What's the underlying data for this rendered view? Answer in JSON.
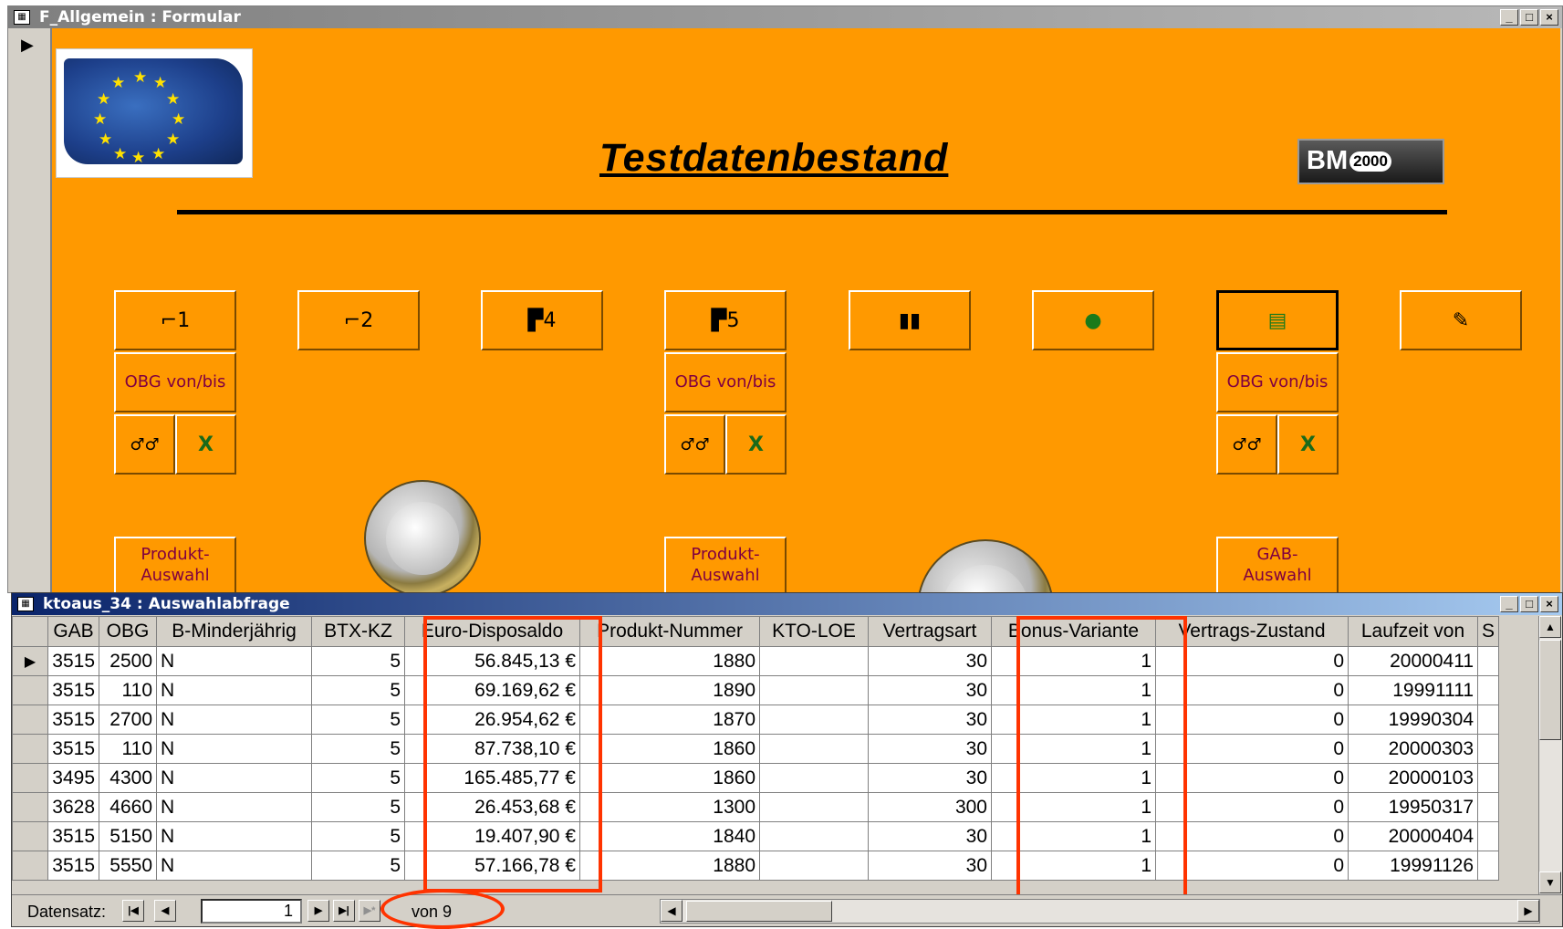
{
  "form_window": {
    "title": "F_Allgemein : Formular",
    "controls": {
      "minimize": "_",
      "maximize": "□",
      "close": "×"
    },
    "heading": "Testdatenbestand",
    "logo_text": "BM",
    "logo_year": "2000",
    "record_indicator": "▶",
    "buttons": {
      "b1": "⌐1",
      "b2": "⌐2",
      "b4": "▛4",
      "b5": "▛5",
      "chart": "▮▮",
      "globe": "●",
      "notebook": "▤",
      "report": "✎",
      "obg1": "OBG von/bis",
      "obg2": "OBG von/bis",
      "obg3": "OBG von/bis",
      "glasses": "♂♂",
      "excel": "X",
      "produkt1_l1": "Produkt-",
      "produkt1_l2": "Auswahl",
      "produkt2_l1": "Produkt-",
      "produkt2_l2": "Auswahl",
      "gab_l1": "GAB-",
      "gab_l2": "Auswahl"
    }
  },
  "query_window": {
    "title": "ktoaus_34 : Auswahlabfrage",
    "columns": [
      "GAB",
      "OBG",
      "B-Minderjährig",
      "BTX-KZ",
      "Euro-Disposaldo",
      "Produkt-Nummer",
      "KTO-LOE",
      "Vertragsart",
      "Bonus-Variante",
      "Vertrags-Zustand",
      "Laufzeit von",
      "S"
    ],
    "rows": [
      {
        "indicator": "▶",
        "gab": "3515",
        "obg": "2500",
        "minder": "N",
        "btx": "5",
        "euro": "56.845,13 €",
        "produkt": "1880",
        "kto": "",
        "vertragsart": "30",
        "bonus": "1",
        "zustand": "0",
        "laufzeit": "20000411",
        "s": ""
      },
      {
        "indicator": "",
        "gab": "3515",
        "obg": "110",
        "minder": "N",
        "btx": "5",
        "euro": "69.169,62 €",
        "produkt": "1890",
        "kto": "",
        "vertragsart": "30",
        "bonus": "1",
        "zustand": "0",
        "laufzeit": "19991111",
        "s": ""
      },
      {
        "indicator": "",
        "gab": "3515",
        "obg": "2700",
        "minder": "N",
        "btx": "5",
        "euro": "26.954,62 €",
        "produkt": "1870",
        "kto": "",
        "vertragsart": "30",
        "bonus": "1",
        "zustand": "0",
        "laufzeit": "19990304",
        "s": ""
      },
      {
        "indicator": "",
        "gab": "3515",
        "obg": "110",
        "minder": "N",
        "btx": "5",
        "euro": "87.738,10 €",
        "produkt": "1860",
        "kto": "",
        "vertragsart": "30",
        "bonus": "1",
        "zustand": "0",
        "laufzeit": "20000303",
        "s": ""
      },
      {
        "indicator": "",
        "gab": "3495",
        "obg": "4300",
        "minder": "N",
        "btx": "5",
        "euro": "165.485,77 €",
        "produkt": "1860",
        "kto": "",
        "vertragsart": "30",
        "bonus": "1",
        "zustand": "0",
        "laufzeit": "20000103",
        "s": ""
      },
      {
        "indicator": "",
        "gab": "3628",
        "obg": "4660",
        "minder": "N",
        "btx": "5",
        "euro": "26.453,68 €",
        "produkt": "1300",
        "kto": "",
        "vertragsart": "300",
        "bonus": "1",
        "zustand": "0",
        "laufzeit": "19950317",
        "s": ""
      },
      {
        "indicator": "",
        "gab": "3515",
        "obg": "5150",
        "minder": "N",
        "btx": "5",
        "euro": "19.407,90 €",
        "produkt": "1840",
        "kto": "",
        "vertragsart": "30",
        "bonus": "1",
        "zustand": "0",
        "laufzeit": "20000404",
        "s": ""
      },
      {
        "indicator": "",
        "gab": "3515",
        "obg": "5550",
        "minder": "N",
        "btx": "5",
        "euro": "57.166,78 €",
        "produkt": "1880",
        "kto": "",
        "vertragsart": "30",
        "bonus": "1",
        "zustand": "0",
        "laufzeit": "19991126",
        "s": ""
      }
    ],
    "nav": {
      "label": "Datensatz:",
      "current": "1",
      "of_text": "von 9",
      "first": "|◀",
      "prev": "◀",
      "next": "▶",
      "last": "▶|",
      "new": "▶*"
    },
    "scroll": {
      "up": "▲",
      "down": "▼",
      "left": "◀",
      "right": "▶"
    }
  },
  "colors": {
    "form_bg": "#ff9900",
    "highlight": "#ff3300",
    "active_title": "#0a246a"
  }
}
